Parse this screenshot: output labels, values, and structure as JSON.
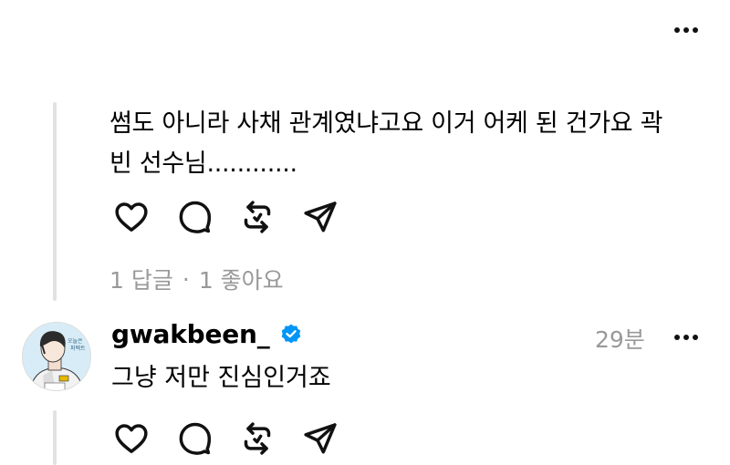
{
  "post": {
    "text_line1": "썸도 아니라 사채 관계였냐고요 이거 어케 된 건가요 곽",
    "text_line2": "빈 선수님............",
    "meta": {
      "replies": "1 답글",
      "separator": "·",
      "likes": "1 좋아요"
    }
  },
  "reply": {
    "username": "gwakbeen_",
    "timestamp": "29분",
    "text": "그냥 저만 진심인거죠",
    "avatar_caption": [
      "오늘은",
      "퍼펙트"
    ]
  },
  "icons": {
    "like": "heart-icon",
    "comment": "comment-icon",
    "repost": "repost-icon",
    "share": "send-icon",
    "more": "more-horizontal-icon",
    "verified": "verified-badge-icon"
  },
  "colors": {
    "verified": "#0095f6",
    "muted_text": "#999999",
    "thread_line": "#e2e2e2"
  }
}
